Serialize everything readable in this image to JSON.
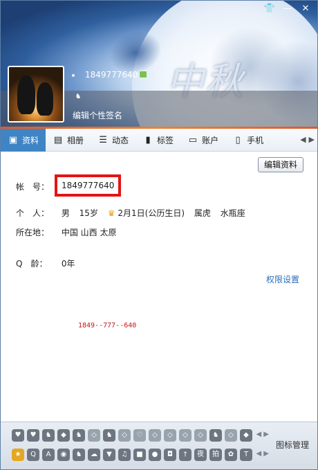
{
  "header": {
    "uin": "1849777640",
    "signature": "编辑个性签名",
    "buttons": {
      "skin": "👕",
      "minimize": "—",
      "close": "✕"
    },
    "calligraphy": "中秋"
  },
  "tabs": [
    {
      "label": "资料",
      "icon": "profile-card-icon"
    },
    {
      "label": "相册",
      "icon": "photo-album-icon"
    },
    {
      "label": "动态",
      "icon": "feed-list-icon"
    },
    {
      "label": "标签",
      "icon": "bookmark-tag-icon"
    },
    {
      "label": "账户",
      "icon": "wallet-icon"
    },
    {
      "label": "手机",
      "icon": "phone-icon"
    }
  ],
  "profile": {
    "edit_button": "编辑资料",
    "account_label": "帐　号：",
    "account_value": "1849777640",
    "personal_label": "个　人：",
    "gender": "男",
    "age": "15岁",
    "birthday": "2月1日(公历生日)",
    "zodiac_cn": "属虎",
    "zodiac_star": "水瓶座",
    "location_label": "所在地：",
    "location_value": "中国 山西 太原",
    "qage_label": "Q　龄：",
    "qage_value": "0年",
    "permission_link": "权限设置",
    "redacted_text": "1849--777--640"
  },
  "iconbar": {
    "manage_label": "图标管理"
  },
  "colors": {
    "accent_tab": "#3f84c5",
    "highlight_box": "#e41414",
    "link": "#2a6ebb"
  }
}
